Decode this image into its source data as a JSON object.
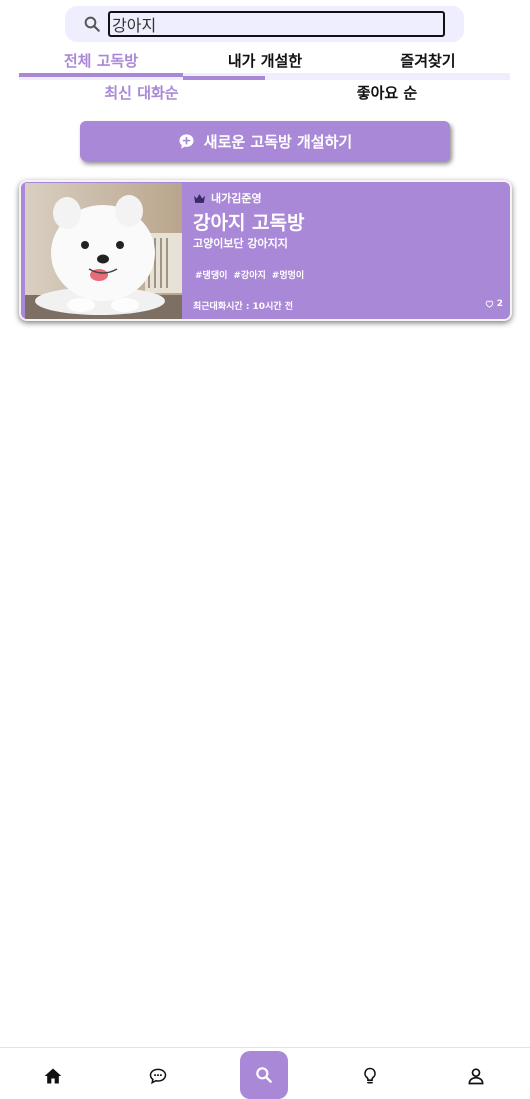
{
  "search": {
    "value": "강아지"
  },
  "main_tabs": [
    {
      "label": "전체 고독방"
    },
    {
      "label": "내가 개설한"
    },
    {
      "label": "즐겨찾기"
    }
  ],
  "sort_tabs": [
    {
      "label": "최신 대화순"
    },
    {
      "label": "좋아요 순"
    }
  ],
  "create_button": {
    "label": "새로운 고독방 개설하기"
  },
  "rooms": [
    {
      "owner": "내가김준영",
      "title": "강아지 고독방",
      "description": "고양이보단 강아지지",
      "tags": [
        "#댕댕이",
        "#강아지",
        "#멍멍이"
      ],
      "last_chat": "최근대화시간 : 10시간 전",
      "likes": "2"
    }
  ],
  "bottom_nav": [
    {
      "icon": "home-icon"
    },
    {
      "icon": "chat-icon"
    },
    {
      "icon": "search-icon"
    },
    {
      "icon": "lightbulb-icon"
    },
    {
      "icon": "user-icon"
    }
  ],
  "colors": {
    "accent": "#aa88d8",
    "light": "#eeeeff"
  }
}
